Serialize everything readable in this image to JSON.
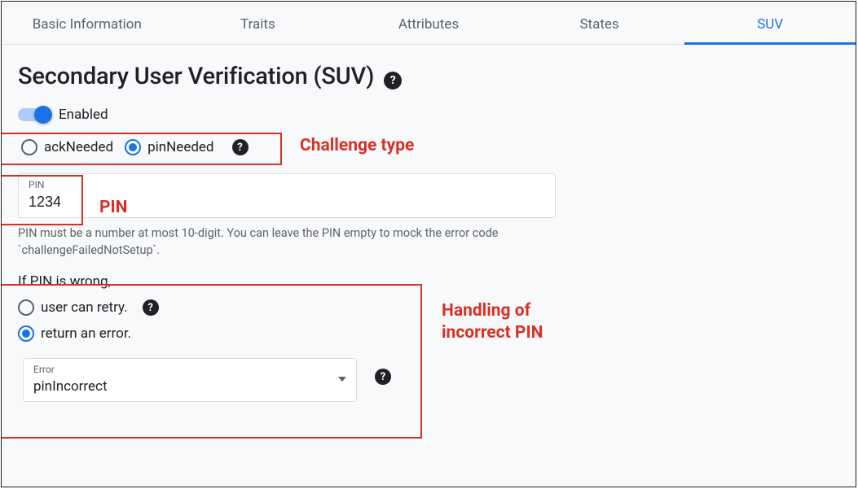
{
  "tabs": [
    {
      "label": "Basic Information",
      "active": false
    },
    {
      "label": "Traits",
      "active": false
    },
    {
      "label": "Attributes",
      "active": false
    },
    {
      "label": "States",
      "active": false
    },
    {
      "label": "SUV",
      "active": true
    }
  ],
  "page": {
    "title": "Secondary User Verification (SUV)",
    "help_glyph": "?"
  },
  "enable": {
    "label": "Enabled",
    "value": true
  },
  "challenge": {
    "options": {
      "ackNeeded": "ackNeeded",
      "pinNeeded": "pinNeeded"
    },
    "selected": "pinNeeded"
  },
  "pin": {
    "label": "PIN",
    "value": "1234",
    "helper": "PIN must be a number at most 10-digit. You can leave the PIN empty to mock the error code `challengeFailedNotSetup`."
  },
  "wrongPin": {
    "prompt": "If PIN is wrong,",
    "options": {
      "retry": "user can retry.",
      "error": "return an error."
    },
    "selected": "error",
    "errorField": {
      "label": "Error",
      "value": "pinIncorrect"
    }
  },
  "annotations": {
    "challengeType": "Challenge type",
    "pin": "PIN",
    "incorrectHandling": "Handling of incorrect PIN"
  }
}
